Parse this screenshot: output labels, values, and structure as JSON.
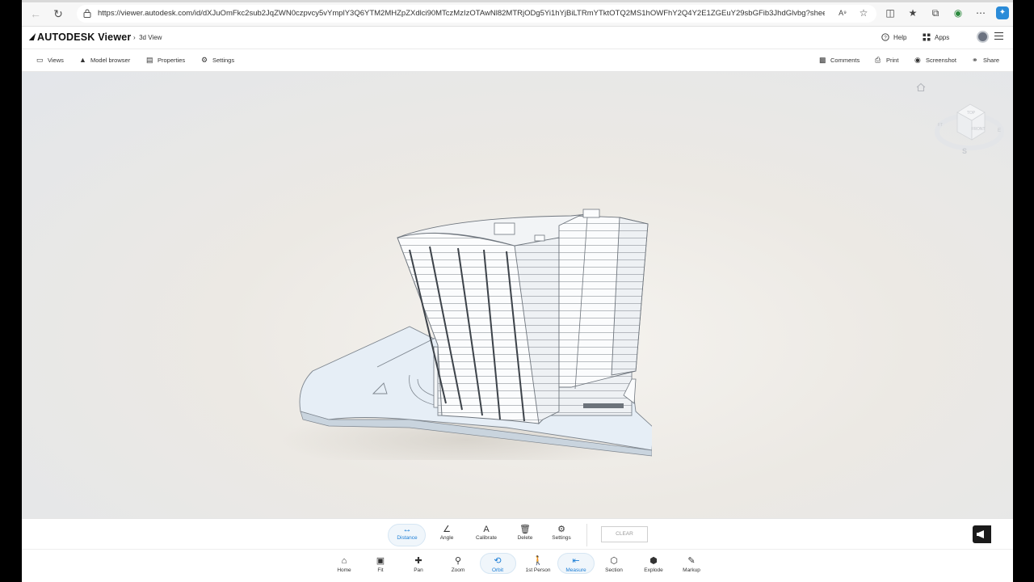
{
  "browser": {
    "url": "https://viewer.autodesk.com/id/dXJuOmFkc2sub2JqZWN0czpvcy5vYmplY3Q6YTM2MHZpZXdlci90MTczMzIzOTAwNl82MTRjODg5Yi1hYjBiLTRmYTktOTQ2MS1hOWFhY2Q4Y2E1ZGEuY29sbGFib3JhdGlvbg?sheetId=NWNhMWJjMz..."
  },
  "header": {
    "logo": "AUTODESK Viewer",
    "breadcrumb": "3d View",
    "help_label": "Help",
    "apps_label": "Apps"
  },
  "toolbar": {
    "left": [
      {
        "label": "Views",
        "icon": "monitor-icon"
      },
      {
        "label": "Model browser",
        "icon": "hierarchy-icon"
      },
      {
        "label": "Properties",
        "icon": "properties-icon"
      },
      {
        "label": "Settings",
        "icon": "gear-icon"
      }
    ],
    "right": [
      {
        "label": "Comments",
        "icon": "comment-icon"
      },
      {
        "label": "Print",
        "icon": "printer-icon"
      },
      {
        "label": "Screenshot",
        "icon": "camera-icon"
      },
      {
        "label": "Share",
        "icon": "link-icon"
      }
    ]
  },
  "viewcube": {
    "top": "TOP",
    "front": "FRONT",
    "left": "FT",
    "compass_s": "S",
    "compass_e": "E"
  },
  "measure_tools": [
    {
      "label": "Distance",
      "icon": "distance-icon",
      "active": true
    },
    {
      "label": "Angle",
      "icon": "angle-icon",
      "active": false
    },
    {
      "label": "Calibrate",
      "icon": "calibrate-icon",
      "active": false
    },
    {
      "label": "Delete",
      "icon": "trash-icon",
      "active": false
    },
    {
      "label": "Settings",
      "icon": "gear-icon",
      "active": false
    }
  ],
  "clear_label": "CLEAR",
  "nav_tools": [
    {
      "label": "Home",
      "icon": "home-icon",
      "active": false
    },
    {
      "label": "Fit",
      "icon": "fit-icon",
      "active": false
    },
    {
      "label": "Pan",
      "icon": "pan-icon",
      "active": false
    },
    {
      "label": "Zoom",
      "icon": "zoom-icon",
      "active": false
    },
    {
      "label": "Orbit",
      "icon": "orbit-icon",
      "active": true
    },
    {
      "label": "1st Person",
      "icon": "person-icon",
      "active": false
    },
    {
      "label": "Measure",
      "icon": "measure-icon",
      "active": true
    },
    {
      "label": "Section",
      "icon": "section-icon",
      "active": false
    },
    {
      "label": "Explode",
      "icon": "explode-icon",
      "active": false
    },
    {
      "label": "Markup",
      "icon": "markup-icon",
      "active": false
    }
  ],
  "colors": {
    "accent": "#1c7ed6"
  }
}
